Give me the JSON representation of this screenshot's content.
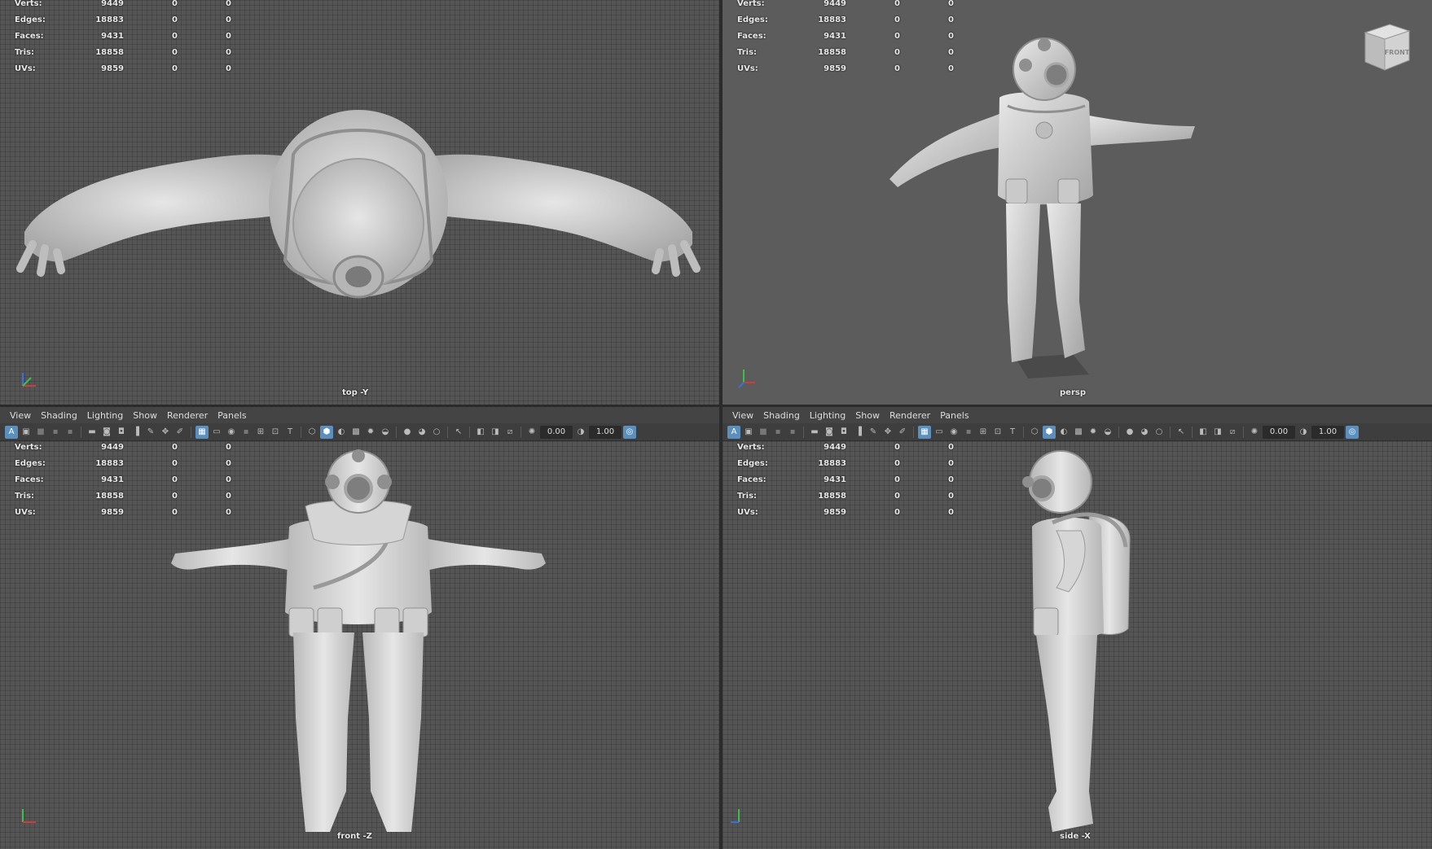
{
  "stats": [
    {
      "label": "Verts:",
      "v1": "9449",
      "v2": "0",
      "v3": "0"
    },
    {
      "label": "Edges:",
      "v1": "18883",
      "v2": "0",
      "v3": "0"
    },
    {
      "label": "Faces:",
      "v1": "9431",
      "v2": "0",
      "v3": "0"
    },
    {
      "label": "Tris:",
      "v1": "18858",
      "v2": "0",
      "v3": "0"
    },
    {
      "label": "UVs:",
      "v1": "9859",
      "v2": "0",
      "v3": "0"
    }
  ],
  "viewports": {
    "top": {
      "camera": "top -Y"
    },
    "persp": {
      "camera": "persp",
      "viewcube_label": "FRONT"
    },
    "front": {
      "camera": "front -Z"
    },
    "side": {
      "camera": "side -X"
    }
  },
  "panel_menu": [
    "View",
    "Shading",
    "Lighting",
    "Show",
    "Renderer",
    "Panels"
  ],
  "toolbar": {
    "exposure_value": "0.00",
    "gamma_value": "1.00"
  },
  "colors": {
    "viewport_grid_bg": "#555555",
    "viewport_persp_bg": "#5c5c5c",
    "model": "#cfcfcf",
    "active_button": "#5a8fbe"
  }
}
